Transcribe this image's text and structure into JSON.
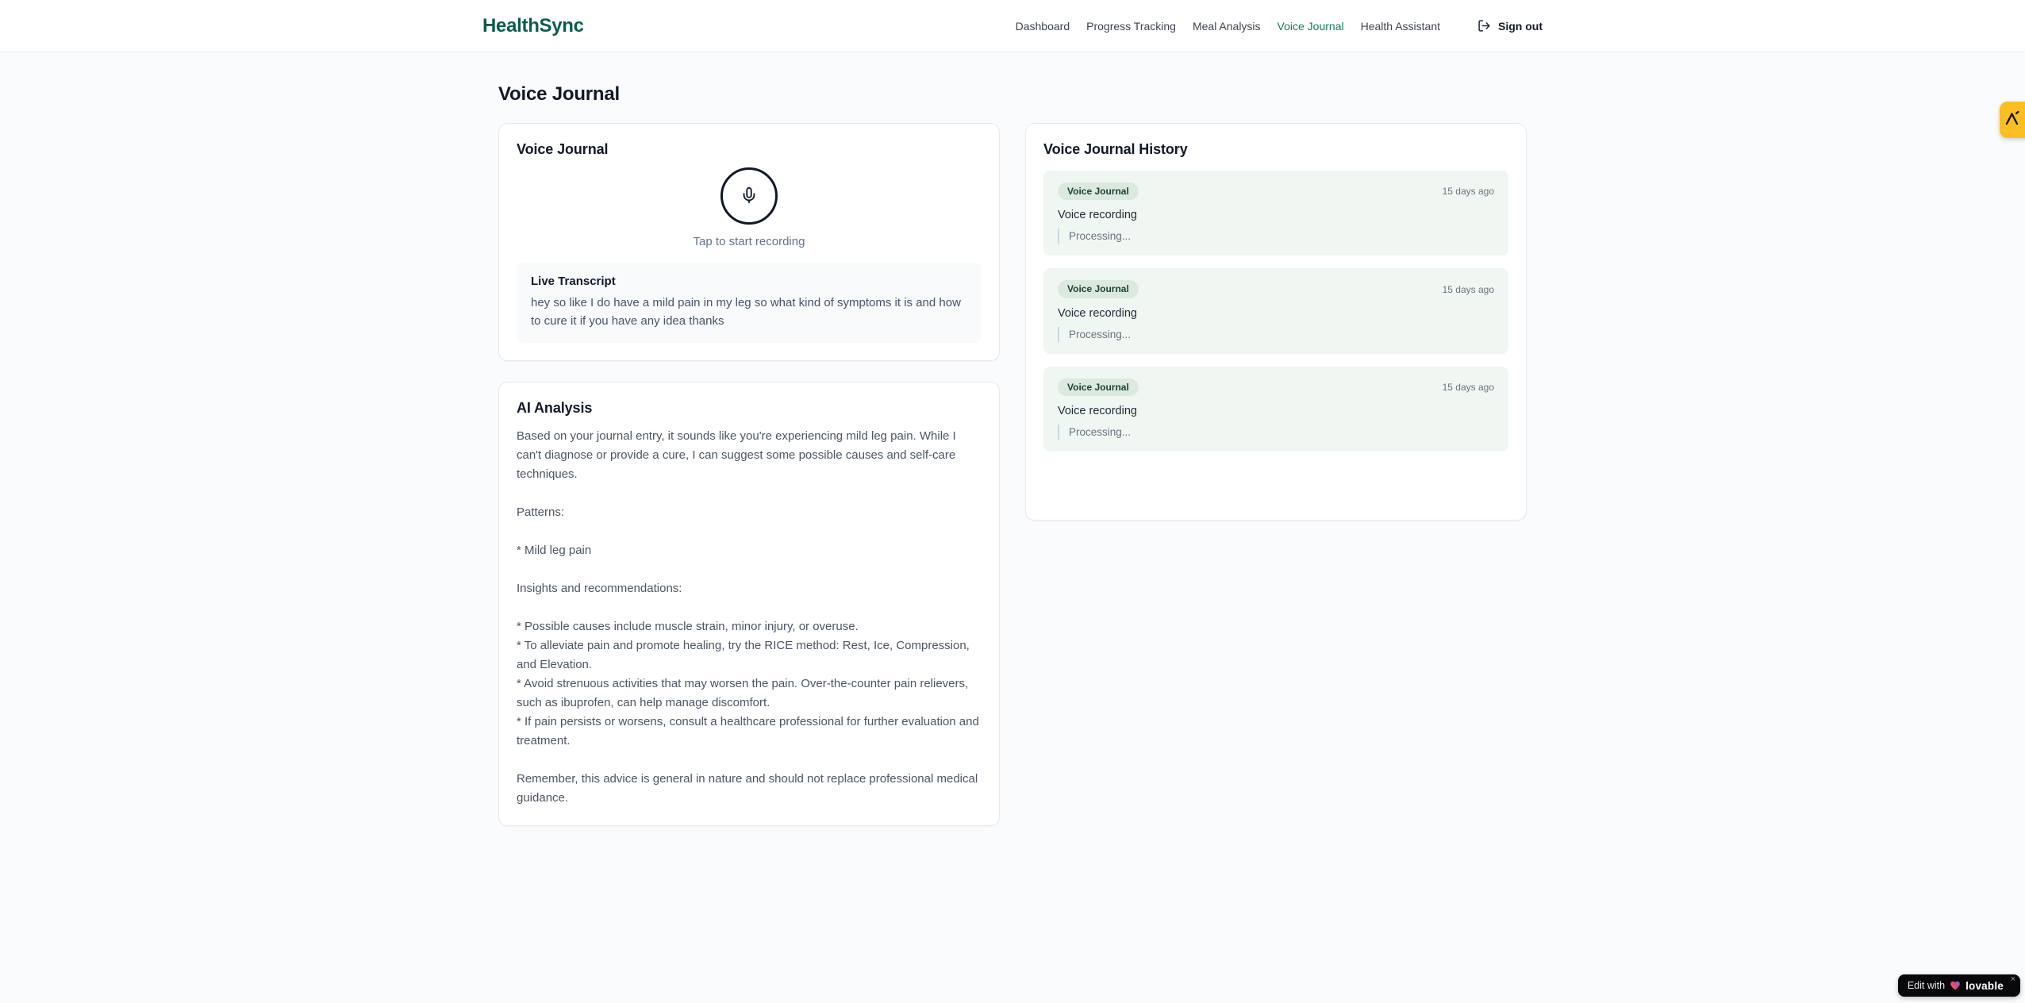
{
  "header": {
    "logo": "HealthSync",
    "nav": [
      {
        "label": "Dashboard",
        "active": false
      },
      {
        "label": "Progress Tracking",
        "active": false
      },
      {
        "label": "Meal Analysis",
        "active": false
      },
      {
        "label": "Voice Journal",
        "active": true
      },
      {
        "label": "Health Assistant",
        "active": false
      }
    ],
    "sign_out_label": "Sign out"
  },
  "page": {
    "title": "Voice Journal"
  },
  "recorder_card": {
    "title": "Voice Journal",
    "tap_hint": "Tap to start recording",
    "transcript_label": "Live Transcript",
    "transcript_text": "hey so like I do have a mild pain in my leg so what kind of symptoms it is and how to cure it if you have any idea thanks"
  },
  "analysis_card": {
    "title": "AI Analysis",
    "body": "Based on your journal entry, it sounds like you're experiencing mild leg pain. While I can't diagnose or provide a cure, I can suggest some possible causes and self-care techniques.\n\nPatterns:\n\n* Mild leg pain\n\nInsights and recommendations:\n\n* Possible causes include muscle strain, minor injury, or overuse.\n* To alleviate pain and promote healing, try the RICE method: Rest, Ice, Compression, and Elevation.\n* Avoid strenuous activities that may worsen the pain. Over-the-counter pain relievers, such as ibuprofen, can help manage discomfort.\n* If pain persists or worsens, consult a healthcare professional for further evaluation and treatment.\n\nRemember, this advice is general in nature and should not replace professional medical guidance."
  },
  "history_card": {
    "title": "Voice Journal History",
    "entries": [
      {
        "badge": "Voice Journal",
        "time": "15 days ago",
        "title": "Voice recording",
        "status": "Processing..."
      },
      {
        "badge": "Voice Journal",
        "time": "15 days ago",
        "title": "Voice recording",
        "status": "Processing..."
      },
      {
        "badge": "Voice Journal",
        "time": "15 days ago",
        "title": "Voice recording",
        "status": "Processing..."
      }
    ]
  },
  "overlays": {
    "edit_badge": {
      "prefix": "Edit with",
      "brand": "lovable",
      "close_label": "×"
    }
  },
  "colors": {
    "brand_teal": "#0b5d4e",
    "active_nav": "#0e7c60",
    "entry_bg": "#f0f7f2",
    "badge_bg": "#dbe9df",
    "badge_text": "#1b4434",
    "amber_badge": "#fbbf24",
    "edit_badge_bg": "#09090b"
  }
}
